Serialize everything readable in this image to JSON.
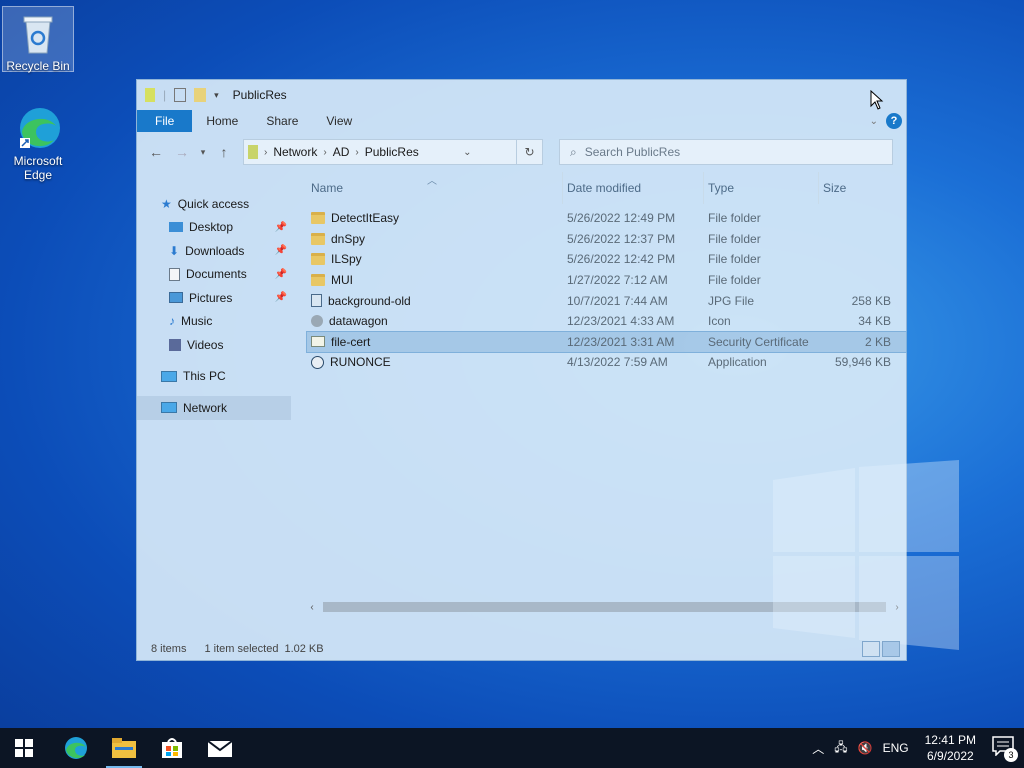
{
  "desktop": {
    "icons": [
      {
        "label": "Recycle Bin",
        "icon": "recycle-bin-icon"
      },
      {
        "label": "Microsoft Edge",
        "icon": "edge-icon"
      }
    ]
  },
  "window": {
    "title": "PublicRes",
    "ribbon": {
      "tabs": [
        "File",
        "Home",
        "Share",
        "View"
      ],
      "help": "?"
    },
    "address": {
      "segments": [
        "Network",
        "AD",
        "PublicRes"
      ]
    },
    "search": {
      "placeholder": "Search PublicRes"
    },
    "navpane": {
      "quick_access": "Quick access",
      "items": [
        "Desktop",
        "Downloads",
        "Documents",
        "Pictures",
        "Music",
        "Videos"
      ],
      "this_pc": "This PC",
      "network": "Network"
    },
    "columns": {
      "name": "Name",
      "date": "Date modified",
      "type": "Type",
      "size": "Size"
    },
    "files": [
      {
        "name": "DetectItEasy",
        "date": "5/26/2022 12:49 PM",
        "type": "File folder",
        "size": "",
        "icon": "folder-icon"
      },
      {
        "name": "dnSpy",
        "date": "5/26/2022 12:37 PM",
        "type": "File folder",
        "size": "",
        "icon": "folder-icon"
      },
      {
        "name": "ILSpy",
        "date": "5/26/2022 12:42 PM",
        "type": "File folder",
        "size": "",
        "icon": "folder-icon"
      },
      {
        "name": "MUI",
        "date": "1/27/2022 7:12 AM",
        "type": "File folder",
        "size": "",
        "icon": "folder-icon"
      },
      {
        "name": "background-old",
        "date": "10/7/2021 7:44 AM",
        "type": "JPG File",
        "size": "258 KB",
        "icon": "image-file-icon"
      },
      {
        "name": "datawagon",
        "date": "12/23/2021 4:33 AM",
        "type": "Icon",
        "size": "34 KB",
        "icon": "icon-file-icon"
      },
      {
        "name": "file-cert",
        "date": "12/23/2021 3:31 AM",
        "type": "Security Certificate",
        "size": "2 KB",
        "icon": "certificate-icon",
        "selected": true
      },
      {
        "name": "RUNONCE",
        "date": "4/13/2022 7:59 AM",
        "type": "Application",
        "size": "59,946 KB",
        "icon": "application-icon"
      }
    ],
    "status": {
      "count": "8 items",
      "selection": "1 item selected",
      "selection_size": "1.02 KB"
    }
  },
  "taskbar": {
    "apps": [
      "start-icon",
      "edge-icon",
      "file-explorer-icon",
      "store-icon",
      "mail-icon"
    ],
    "tray": {
      "language": "ENG",
      "time": "12:41 PM",
      "date": "6/9/2022",
      "notifications": "3"
    }
  }
}
